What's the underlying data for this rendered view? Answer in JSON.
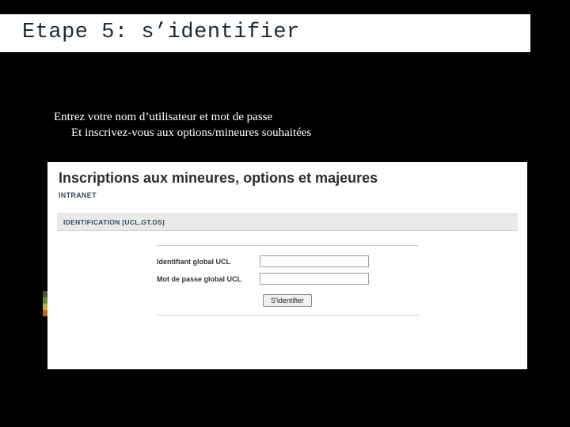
{
  "title": "Etape 5: s’identifier",
  "intro": {
    "line1": "Entrez votre nom d’utilisateur et mot de passe",
    "line2": "Et inscrivez-vous aux options/mineures souhaitées"
  },
  "screenshot": {
    "page_title": "Inscriptions aux mineures, options et majeures",
    "intranet_label": "INTRANET",
    "section_label": "IDENTIFICATION [UCL.GT.DS]",
    "field_user_label": "Identifiant global UCL",
    "field_pass_label": "Mot de passe global UCL",
    "button_label": "S'identifier"
  }
}
